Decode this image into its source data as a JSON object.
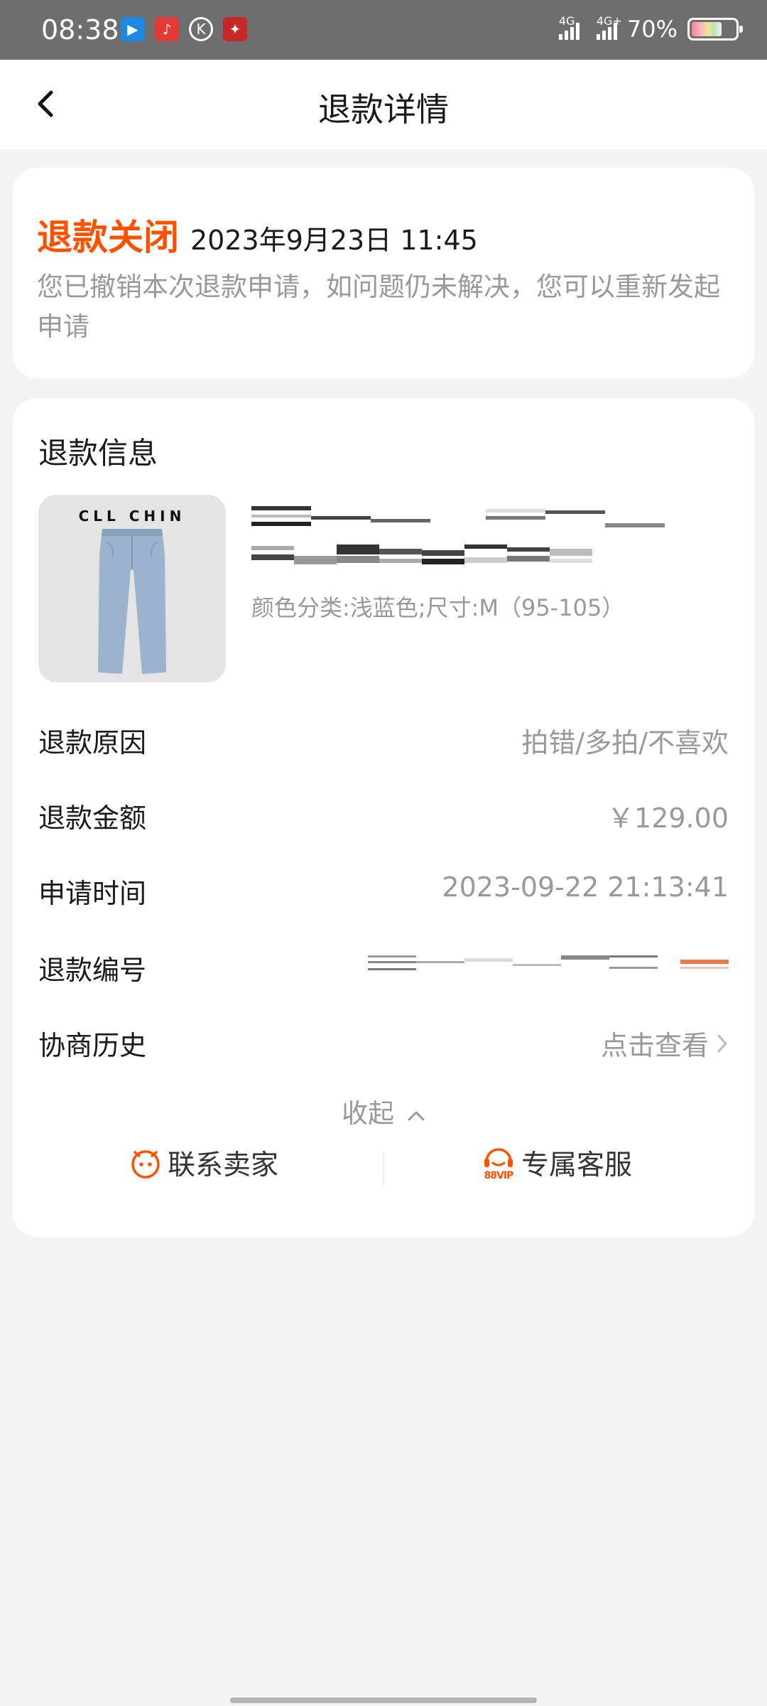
{
  "status_bar": {
    "time": "08:38",
    "signal_1": "4G",
    "signal_2": "4G+",
    "battery": "70%",
    "app_icons": [
      "video-app-icon",
      "listen-app-icon",
      "k-app-icon",
      "red-app-icon"
    ]
  },
  "header": {
    "title": "退款详情"
  },
  "refund_status": {
    "state": "退款关闭",
    "time": "2023年9月23日 11:45",
    "description": "您已撤销本次退款申请，如问题仍未解决，您可以重新发起申请"
  },
  "refund_info": {
    "section_title": "退款信息",
    "product": {
      "brand": "CLL CHIN",
      "variant": "颜色分类:浅蓝色;尺寸:M（95-105）"
    },
    "rows": [
      {
        "label": "退款原因",
        "value": "拍错/多拍/不喜欢"
      },
      {
        "label": "退款金额",
        "value": "￥129.00"
      },
      {
        "label": "申请时间",
        "value": "2023-09-22 21:13:41"
      },
      {
        "label": "退款编号",
        "value": ""
      },
      {
        "label": "协商历史",
        "value": "点击查看"
      }
    ],
    "collapse_label": "收起",
    "actions": {
      "contact_seller": "联系卖家",
      "vip_service": "专属客服",
      "vip_badge": "88VIP"
    }
  },
  "colors": {
    "accent": "#ff5000",
    "muted": "#999999"
  }
}
